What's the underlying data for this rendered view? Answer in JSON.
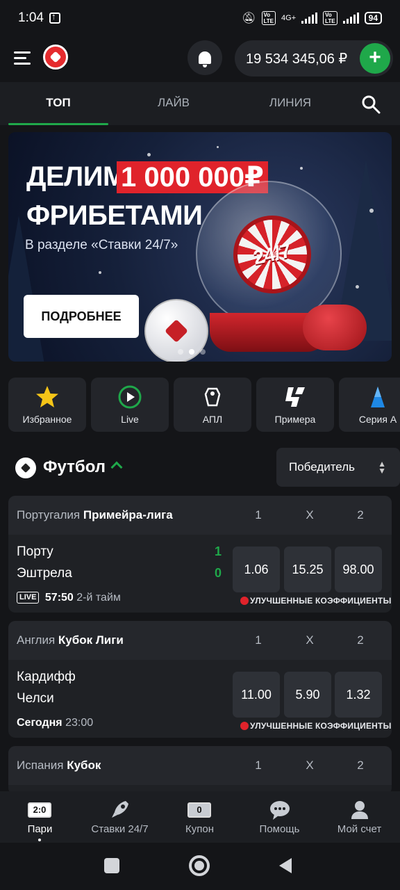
{
  "status_bar": {
    "time": "1:04",
    "battery": "94",
    "network": "4G+"
  },
  "header": {
    "balance": "19 534 345,06 ₽",
    "add_label": "+"
  },
  "tabs": [
    {
      "label": "ТОП",
      "active": true
    },
    {
      "label": "ЛАЙВ",
      "active": false
    },
    {
      "label": "ЛИНИЯ",
      "active": false
    }
  ],
  "banner": {
    "line1": "ДЕЛИМ",
    "amount": "1 000 000₽",
    "line2": "ФРИБЕТАМИ",
    "subtitle": "В разделе «Ставки 24/7»",
    "button": "ПОДРОБНЕЕ",
    "badge": "24/7"
  },
  "categories": [
    {
      "label": "Избранное",
      "icon": "star-icon"
    },
    {
      "label": "Live",
      "icon": "play-icon"
    },
    {
      "label": "АПЛ",
      "icon": "premier-league-icon"
    },
    {
      "label": "Примера",
      "icon": "laliga-icon"
    },
    {
      "label": "Серия А",
      "icon": "serie-a-icon"
    }
  ],
  "sport": {
    "title": "Футбол",
    "market": "Победитель"
  },
  "events": [
    {
      "country": "Португалия",
      "league": "Примейра-лига",
      "h1": "1",
      "hx": "X",
      "h2": "2",
      "team1": "Порту",
      "team2": "Эштрела",
      "score1": "1",
      "score2": "0",
      "live": "LIVE",
      "time": "57:50",
      "period": "2-й тайм",
      "odds": [
        "1.06",
        "15.25",
        "98.00"
      ],
      "boost": "УЛУЧШЕННЫЕ КОЭФФИЦИЕНТЫ"
    },
    {
      "country": "Англия",
      "league": "Кубок Лиги",
      "h1": "1",
      "hx": "X",
      "h2": "2",
      "team1": "Кардифф",
      "team2": "Челси",
      "day": "Сегодня",
      "time": "23:00",
      "odds": [
        "11.00",
        "5.90",
        "1.32"
      ],
      "boost": "УЛУЧШЕННЫЕ КОЭФФИЦИЕНТЫ"
    },
    {
      "country": "Испания",
      "league": "Кубок",
      "h1": "1",
      "hx": "X",
      "h2": "2"
    }
  ],
  "bottom_nav": [
    {
      "label": "Пари",
      "badge": "2:0",
      "active": true
    },
    {
      "label": "Ставки 24/7",
      "icon": "rocket-icon"
    },
    {
      "label": "Купон",
      "badge": "0"
    },
    {
      "label": "Помощь",
      "icon": "chat-icon"
    },
    {
      "label": "Мой счет",
      "icon": "user-icon"
    }
  ],
  "colors": {
    "accent": "#1fa84a",
    "promo_red": "#e0232b",
    "background": "#141518"
  }
}
